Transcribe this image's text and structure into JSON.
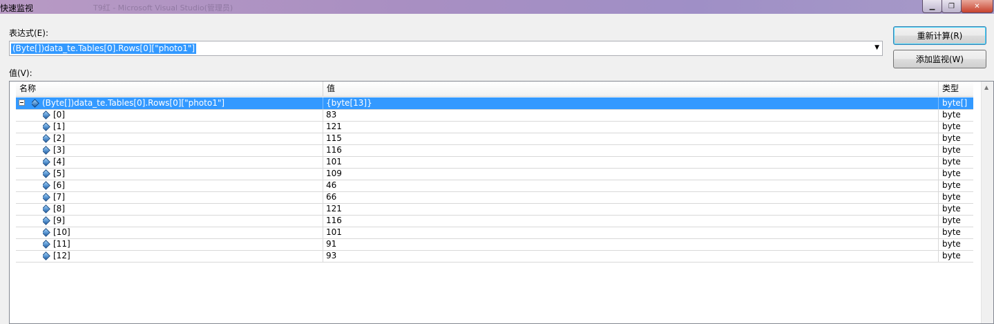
{
  "window": {
    "title": "快速监视",
    "background_title": "T9红 - Microsoft Visual Studio(管理员)"
  },
  "expression": {
    "label": "表达式(E):",
    "value": "(Byte[])data_te.Tables[0].Rows[0][\"photo1\"]"
  },
  "buttons": {
    "recalculate": "重新计算(R)",
    "add_watch": "添加监视(W)"
  },
  "value_label": "值(V):",
  "grid": {
    "columns": {
      "name": "名称",
      "value": "值",
      "type": "类型"
    },
    "root": {
      "name": "(Byte[])data_te.Tables[0].Rows[0][\"photo1\"]",
      "value": "{byte[13]}",
      "type": "byte[]"
    },
    "rows": [
      {
        "name": "[0]",
        "value": "83",
        "type": "byte"
      },
      {
        "name": "[1]",
        "value": "121",
        "type": "byte"
      },
      {
        "name": "[2]",
        "value": "115",
        "type": "byte"
      },
      {
        "name": "[3]",
        "value": "116",
        "type": "byte"
      },
      {
        "name": "[4]",
        "value": "101",
        "type": "byte"
      },
      {
        "name": "[5]",
        "value": "109",
        "type": "byte"
      },
      {
        "name": "[6]",
        "value": "46",
        "type": "byte"
      },
      {
        "name": "[7]",
        "value": "66",
        "type": "byte"
      },
      {
        "name": "[8]",
        "value": "121",
        "type": "byte"
      },
      {
        "name": "[9]",
        "value": "116",
        "type": "byte"
      },
      {
        "name": "[10]",
        "value": "101",
        "type": "byte"
      },
      {
        "name": "[11]",
        "value": "91",
        "type": "byte"
      },
      {
        "name": "[12]",
        "value": "93",
        "type": "byte"
      }
    ]
  },
  "icons": {
    "member": "field-diamond-icon",
    "collapse": "collapse-minus-icon"
  },
  "colors": {
    "selection": "#3399ff",
    "titlebar": "#a98fc2"
  }
}
